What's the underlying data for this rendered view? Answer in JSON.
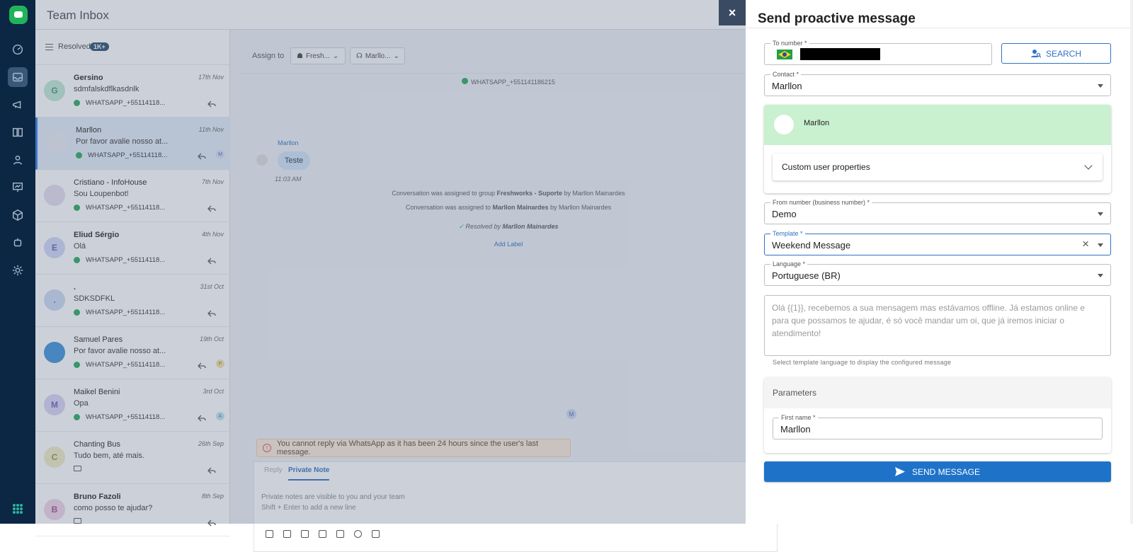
{
  "app": {
    "title": "Team Inbox"
  },
  "list": {
    "filter_label": "Resolved",
    "filter_count": "1K+",
    "conversations": [
      {
        "name": "Gersino",
        "bold": true,
        "message": "sdmfalskdflkasdnlk",
        "date": "17th Nov",
        "channel": "WHATSAPP_+55114118...",
        "initial": "G",
        "avatar_color": "#bfe7d3",
        "initial_color": "#3a9a6a"
      },
      {
        "name": "Marllon",
        "bold": false,
        "message": "Por favor avalie nosso at...",
        "date": "11th Nov",
        "channel": "WHATSAPP_+55114118...",
        "initial": "",
        "avatar_color": "#e9ecf1",
        "initial_color": "#333",
        "agent": "M"
      },
      {
        "name": "Cristiano - InfoHouse",
        "bold": false,
        "message": "Sou Loupenbot!",
        "date": "7th Nov",
        "channel": "WHATSAPP_+55114118...",
        "initial": "",
        "avatar_color": "#e4dbef",
        "initial_color": "#6b3fa0"
      },
      {
        "name": "Eliud Sérgio",
        "bold": true,
        "message": "Olá",
        "date": "4th Nov",
        "channel": "WHATSAPP_+55114118...",
        "initial": "E",
        "avatar_color": "#cfd6f5",
        "initial_color": "#5563c1"
      },
      {
        "name": ".",
        "bold": true,
        "message": "SDKSDFKL",
        "date": "31st Oct",
        "channel": "WHATSAPP_+55114118...",
        "initial": ".",
        "avatar_color": "#cbd9f2",
        "initial_color": "#4a6ab0"
      },
      {
        "name": "Samuel Pares",
        "bold": false,
        "message": "Por favor avalie nosso at...",
        "date": "19th Oct",
        "channel": "WHATSAPP_+55114118...",
        "initial": "",
        "avatar_color": "#3d8ed8",
        "initial_color": "#fff",
        "agent": "P"
      },
      {
        "name": "Maikel Benini",
        "bold": false,
        "message": "Opa",
        "date": "3rd Oct",
        "channel": "WHATSAPP_+55114118...",
        "initial": "M",
        "avatar_color": "#d8d3f2",
        "initial_color": "#6a5bbf",
        "agent": "A"
      },
      {
        "name": "Chanting Bus",
        "bold": false,
        "message": "Tudo bem, até mais.",
        "date": "26th Sep",
        "channel": "",
        "initial": "C",
        "avatar_color": "#f1ebc4",
        "initial_color": "#a18f2a"
      },
      {
        "name": "Bruno Fazoli",
        "bold": true,
        "message": "como posso te ajudar?",
        "date": "8th Sep",
        "channel": "",
        "initial": "B",
        "avatar_color": "#f0d2e6",
        "initial_color": "#a04b86"
      }
    ]
  },
  "chat": {
    "assign_label": "Assign to",
    "group_chip": "Fresh...",
    "agent_chip": "Marllo...",
    "channel_line": "WHATSAPP_+551141186215",
    "sender": "Marllon",
    "bubble_text": "Teste",
    "bubble_time": "11:03 AM",
    "sys1_prefix": "Conversation was assigned to group ",
    "sys1_bold": "Freshworks - Suporte",
    "sys1_suffix": " by Marllon Mainardes",
    "sys2_prefix": "Conversation was assigned to ",
    "sys2_bold": "Marllon Mainardes",
    "sys2_suffix": " by Marllon Mainardes",
    "resolved_prefix": "Resolved by ",
    "resolved_by": "Marllon Mainardes",
    "add_label": "Add Label",
    "agent_marker": "M",
    "warning": "You cannot reply via WhatsApp as it has been 24 hours since the user's last message.",
    "tab_reply": "Reply",
    "tab_note": "Private Note",
    "note_placeholder_1": "Private notes are visible to you and your team",
    "note_placeholder_2": "Shift + Enter to add a new line"
  },
  "drawer": {
    "close_label": "×",
    "title": "Send proactive message",
    "to_number_label": "To number *",
    "search_label": "SEARCH",
    "contact_label": "Contact *",
    "contact_value": "Marllon",
    "card_name": "Marllon",
    "custom_props_label": "Custom user properties",
    "from_label": "From number (business number) *",
    "from_value": "Demo",
    "template_label": "Template *",
    "template_value": "Weekend Message",
    "clear_label": "×",
    "language_label": "Language *",
    "language_value": "Portuguese (BR)",
    "template_text": "Olá {{1}}, recebemos a sua mensagem mas estávamos offline. Já estamos online e para que possamos te ajudar, é só você mandar um oi, que já iremos iniciar o atendimento!",
    "helper_text": "Select template language to display the configured message",
    "parameters_label": "Parameters",
    "first_name_label": "First name *",
    "first_name_value": "Marllon",
    "send_label": "SEND MESSAGE"
  },
  "colors": {
    "primary": "#1e73c8",
    "rail": "#0b2744",
    "success_bg": "#c9f0cf",
    "whatsapp": "#25a85a"
  }
}
